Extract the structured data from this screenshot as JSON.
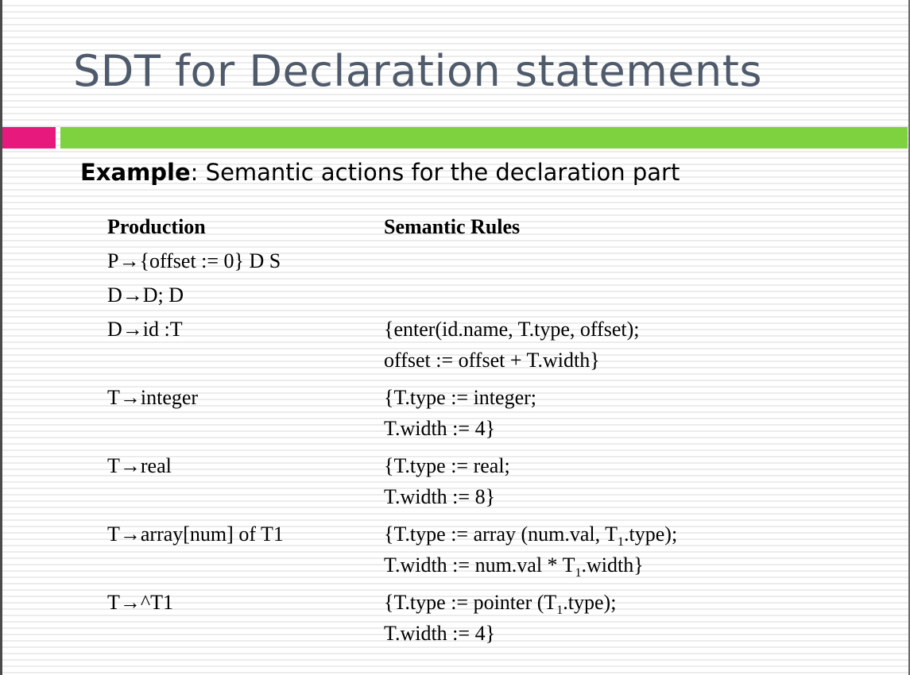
{
  "slide": {
    "title": "SDT for Declaration statements",
    "accent_colors": {
      "pink": "#e8197d",
      "green": "#7ed13f",
      "title_text": "#4f5b6b"
    },
    "example": {
      "label": "Example",
      "text": ": Semantic actions for the declaration part"
    }
  },
  "table": {
    "headers": {
      "production": "Production",
      "semantic_rules": "Semantic Rules"
    },
    "rows": [
      {
        "production": "P→{offset := 0} D S",
        "rules": []
      },
      {
        "production": "D→D; D",
        "rules": []
      },
      {
        "production": "D→id :T",
        "rules": [
          "{enter(id.name, T.type, offset);",
          "offset := offset + T.width}"
        ]
      },
      {
        "production": "T→integer",
        "rules": [
          "{T.type := integer;",
          "T.width := 4}"
        ]
      },
      {
        "production": "T→real",
        "rules": [
          "{T.type := real;",
          "T.width := 8}"
        ]
      },
      {
        "production": "T→array[num] of T1",
        "rules": [
          {
            "before": "{T.type := array (num.val, T",
            "sub": "1",
            "after": ".type);"
          },
          {
            "before": "T.width := num.val * T",
            "sub": "1",
            "after": ".width}"
          }
        ]
      },
      {
        "production": "T→^T1",
        "rules": [
          {
            "before": "{T.type := pointer (T",
            "sub": "1",
            "after": ".type);"
          },
          "T.width := 4}"
        ]
      }
    ]
  }
}
